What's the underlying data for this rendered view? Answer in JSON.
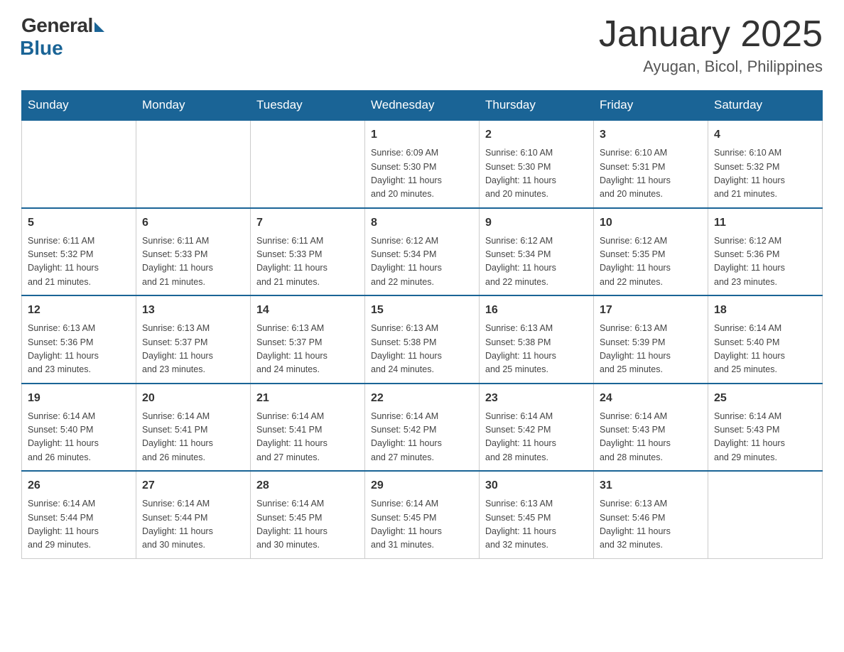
{
  "logo": {
    "general": "General",
    "blue": "Blue"
  },
  "title": "January 2025",
  "location": "Ayugan, Bicol, Philippines",
  "weekdays": [
    "Sunday",
    "Monday",
    "Tuesday",
    "Wednesday",
    "Thursday",
    "Friday",
    "Saturday"
  ],
  "weeks": [
    [
      {
        "day": "",
        "info": ""
      },
      {
        "day": "",
        "info": ""
      },
      {
        "day": "",
        "info": ""
      },
      {
        "day": "1",
        "info": "Sunrise: 6:09 AM\nSunset: 5:30 PM\nDaylight: 11 hours\nand 20 minutes."
      },
      {
        "day": "2",
        "info": "Sunrise: 6:10 AM\nSunset: 5:30 PM\nDaylight: 11 hours\nand 20 minutes."
      },
      {
        "day": "3",
        "info": "Sunrise: 6:10 AM\nSunset: 5:31 PM\nDaylight: 11 hours\nand 20 minutes."
      },
      {
        "day": "4",
        "info": "Sunrise: 6:10 AM\nSunset: 5:32 PM\nDaylight: 11 hours\nand 21 minutes."
      }
    ],
    [
      {
        "day": "5",
        "info": "Sunrise: 6:11 AM\nSunset: 5:32 PM\nDaylight: 11 hours\nand 21 minutes."
      },
      {
        "day": "6",
        "info": "Sunrise: 6:11 AM\nSunset: 5:33 PM\nDaylight: 11 hours\nand 21 minutes."
      },
      {
        "day": "7",
        "info": "Sunrise: 6:11 AM\nSunset: 5:33 PM\nDaylight: 11 hours\nand 21 minutes."
      },
      {
        "day": "8",
        "info": "Sunrise: 6:12 AM\nSunset: 5:34 PM\nDaylight: 11 hours\nand 22 minutes."
      },
      {
        "day": "9",
        "info": "Sunrise: 6:12 AM\nSunset: 5:34 PM\nDaylight: 11 hours\nand 22 minutes."
      },
      {
        "day": "10",
        "info": "Sunrise: 6:12 AM\nSunset: 5:35 PM\nDaylight: 11 hours\nand 22 minutes."
      },
      {
        "day": "11",
        "info": "Sunrise: 6:12 AM\nSunset: 5:36 PM\nDaylight: 11 hours\nand 23 minutes."
      }
    ],
    [
      {
        "day": "12",
        "info": "Sunrise: 6:13 AM\nSunset: 5:36 PM\nDaylight: 11 hours\nand 23 minutes."
      },
      {
        "day": "13",
        "info": "Sunrise: 6:13 AM\nSunset: 5:37 PM\nDaylight: 11 hours\nand 23 minutes."
      },
      {
        "day": "14",
        "info": "Sunrise: 6:13 AM\nSunset: 5:37 PM\nDaylight: 11 hours\nand 24 minutes."
      },
      {
        "day": "15",
        "info": "Sunrise: 6:13 AM\nSunset: 5:38 PM\nDaylight: 11 hours\nand 24 minutes."
      },
      {
        "day": "16",
        "info": "Sunrise: 6:13 AM\nSunset: 5:38 PM\nDaylight: 11 hours\nand 25 minutes."
      },
      {
        "day": "17",
        "info": "Sunrise: 6:13 AM\nSunset: 5:39 PM\nDaylight: 11 hours\nand 25 minutes."
      },
      {
        "day": "18",
        "info": "Sunrise: 6:14 AM\nSunset: 5:40 PM\nDaylight: 11 hours\nand 25 minutes."
      }
    ],
    [
      {
        "day": "19",
        "info": "Sunrise: 6:14 AM\nSunset: 5:40 PM\nDaylight: 11 hours\nand 26 minutes."
      },
      {
        "day": "20",
        "info": "Sunrise: 6:14 AM\nSunset: 5:41 PM\nDaylight: 11 hours\nand 26 minutes."
      },
      {
        "day": "21",
        "info": "Sunrise: 6:14 AM\nSunset: 5:41 PM\nDaylight: 11 hours\nand 27 minutes."
      },
      {
        "day": "22",
        "info": "Sunrise: 6:14 AM\nSunset: 5:42 PM\nDaylight: 11 hours\nand 27 minutes."
      },
      {
        "day": "23",
        "info": "Sunrise: 6:14 AM\nSunset: 5:42 PM\nDaylight: 11 hours\nand 28 minutes."
      },
      {
        "day": "24",
        "info": "Sunrise: 6:14 AM\nSunset: 5:43 PM\nDaylight: 11 hours\nand 28 minutes."
      },
      {
        "day": "25",
        "info": "Sunrise: 6:14 AM\nSunset: 5:43 PM\nDaylight: 11 hours\nand 29 minutes."
      }
    ],
    [
      {
        "day": "26",
        "info": "Sunrise: 6:14 AM\nSunset: 5:44 PM\nDaylight: 11 hours\nand 29 minutes."
      },
      {
        "day": "27",
        "info": "Sunrise: 6:14 AM\nSunset: 5:44 PM\nDaylight: 11 hours\nand 30 minutes."
      },
      {
        "day": "28",
        "info": "Sunrise: 6:14 AM\nSunset: 5:45 PM\nDaylight: 11 hours\nand 30 minutes."
      },
      {
        "day": "29",
        "info": "Sunrise: 6:14 AM\nSunset: 5:45 PM\nDaylight: 11 hours\nand 31 minutes."
      },
      {
        "day": "30",
        "info": "Sunrise: 6:13 AM\nSunset: 5:45 PM\nDaylight: 11 hours\nand 32 minutes."
      },
      {
        "day": "31",
        "info": "Sunrise: 6:13 AM\nSunset: 5:46 PM\nDaylight: 11 hours\nand 32 minutes."
      },
      {
        "day": "",
        "info": ""
      }
    ]
  ]
}
